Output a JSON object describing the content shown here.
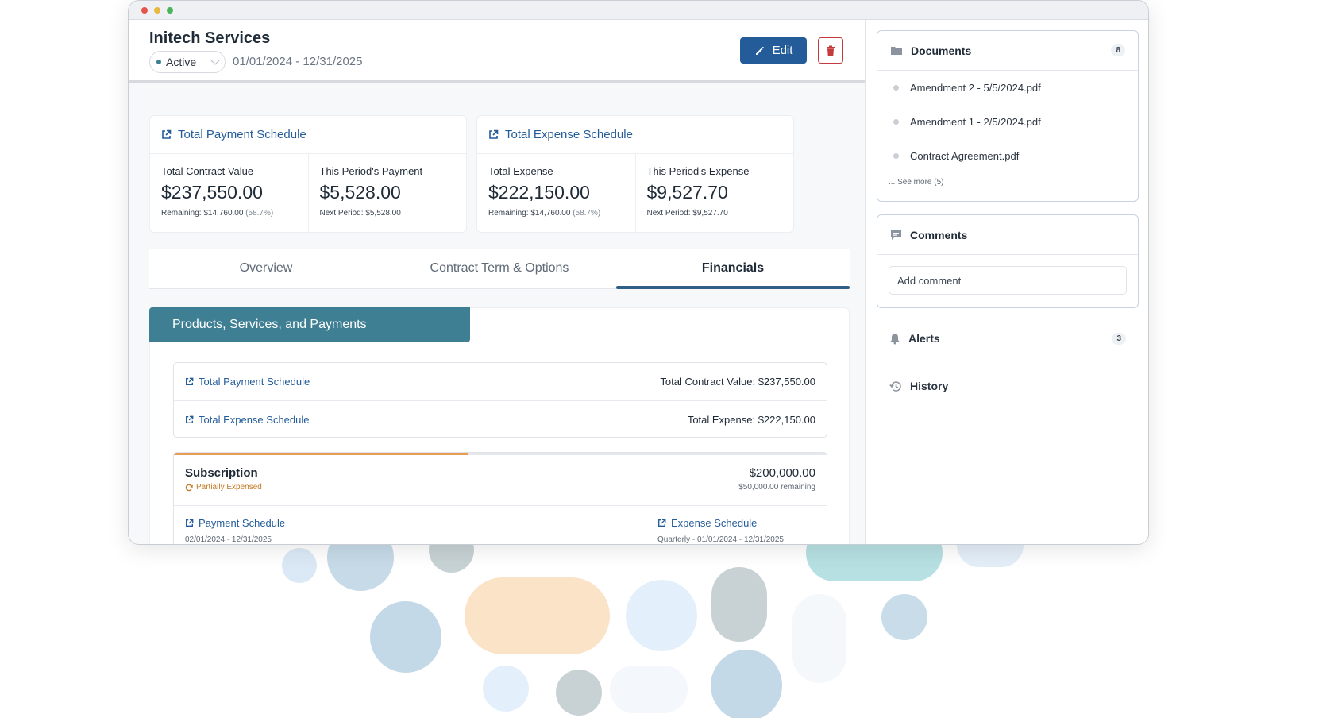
{
  "window": {
    "dots": [
      "#e5534b",
      "#e9b83d",
      "#4cb35a"
    ]
  },
  "header": {
    "title": "Initech Services",
    "status": "Active",
    "status_color": "#3f7f93",
    "dates": "01/01/2024 - 12/31/2025",
    "edit_label": "Edit",
    "accent": "#245c9a",
    "delete_color": "#c53b3b"
  },
  "cards": [
    {
      "title": "Total Payment Schedule",
      "cells": [
        {
          "label": "Total Contract Value",
          "value": "$237,550.00",
          "sub": "Remaining: $14,760.00",
          "pct": "(58.7%)"
        },
        {
          "label": "This Period's Payment",
          "value": "$5,528.00",
          "sub": "Next Period: $5,528.00",
          "pct": ""
        }
      ]
    },
    {
      "title": "Total Expense Schedule",
      "cells": [
        {
          "label": "Total Expense",
          "value": "$222,150.00",
          "sub": "Remaining: $14,760.00",
          "pct": "(58.7%)"
        },
        {
          "label": "This Period's Expense",
          "value": "$9,527.70",
          "sub": "Next Period: $9,527.70",
          "pct": ""
        }
      ]
    }
  ],
  "tabs": [
    {
      "label": "Overview",
      "active": false
    },
    {
      "label": "Contract Term & Options",
      "active": false
    },
    {
      "label": "Financials",
      "active": true
    }
  ],
  "panel": {
    "title": "Products, Services, and Payments",
    "title_bg": "#3f7f93",
    "rows": [
      {
        "link": "Total Payment Schedule",
        "value": "Total Contract Value: $237,550.00"
      },
      {
        "link": "Total Expense Schedule",
        "value": "Total Expense: $222,150.00"
      }
    ],
    "subscription": {
      "name": "Subscription",
      "status": "Partially Expensed",
      "amount": "$200,000.00",
      "remaining": "$50,000.00 remaining",
      "progress": 0.45,
      "payment_link": "Payment Schedule",
      "payment_meta": "02/01/2024 - 12/31/2025",
      "expense_link": "Expense Schedule",
      "expense_meta": "Quarterly - 01/01/2024 - 12/31/2025"
    }
  },
  "sidebar": {
    "documents": {
      "title": "Documents",
      "count": "8",
      "items": [
        "Amendment 2 - 5/5/2024.pdf",
        "Amendment 1 - 2/5/2024.pdf",
        "Contract Agreement.pdf"
      ],
      "see_more": "... See more (5)"
    },
    "comments": {
      "title": "Comments",
      "placeholder": "Add comment"
    },
    "alerts": {
      "title": "Alerts",
      "count": "3"
    },
    "history": {
      "title": "History"
    }
  }
}
